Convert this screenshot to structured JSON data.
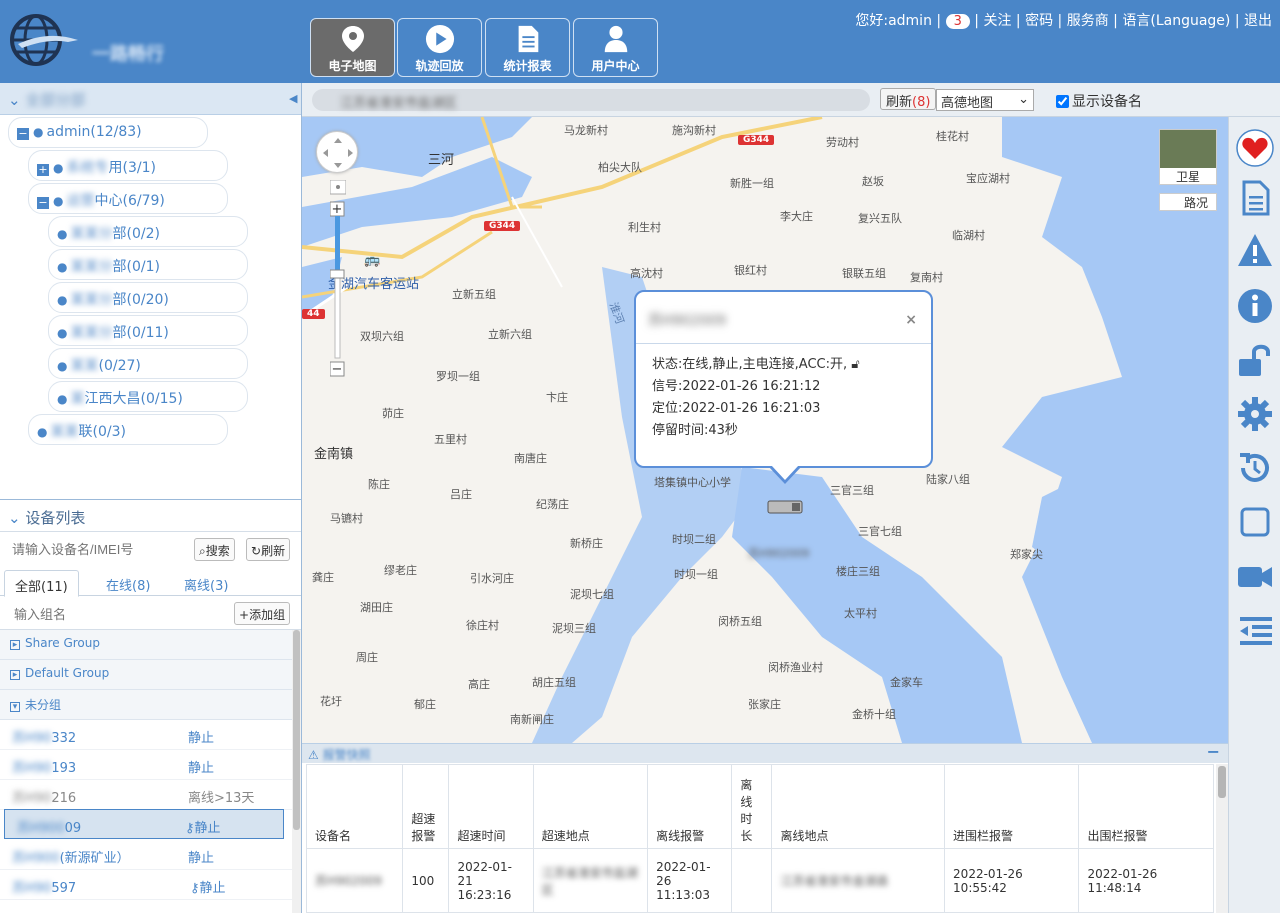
{
  "header": {
    "logo_text": "一路畅行",
    "nav": [
      {
        "label": "电子地图",
        "icon": "map-pin-icon"
      },
      {
        "label": "轨迹回放",
        "icon": "play-icon"
      },
      {
        "label": "统计报表",
        "icon": "document-icon"
      },
      {
        "label": "用户中心",
        "icon": "user-icon"
      }
    ],
    "greeting": "您好:admin",
    "message_count": "3",
    "links": [
      "关注",
      "密码",
      "服务商",
      "语言(Language)",
      "退出"
    ]
  },
  "tree": {
    "header": "全部分部",
    "nodes": [
      {
        "label": "admin(12/83)"
      },
      {
        "blur": "系统专",
        "label": "用(3/1)"
      },
      {
        "blur": "运营",
        "label": "中心(6/79)"
      },
      {
        "blur": "某某分",
        "label": "部(0/2)"
      },
      {
        "blur": "某某分",
        "label": "部(0/1)"
      },
      {
        "blur": "某某分",
        "label": "部(0/20)"
      },
      {
        "blur": "某某分",
        "label": "部(0/11)"
      },
      {
        "blur": "某某",
        "label": "(0/27)"
      },
      {
        "blur": "某",
        "label": "江西大昌(0/15)"
      },
      {
        "blur": "某某",
        "label": "联(0/3)"
      }
    ]
  },
  "devices": {
    "header": "设备列表",
    "search_placeholder": "请输入设备名/IMEI号",
    "search_btn": "搜索",
    "refresh_btn": "刷新",
    "tabs": [
      "全部(11)",
      "在线(8)",
      "离线(3)"
    ],
    "group_placeholder": "输入组名",
    "add_group": "添加组",
    "groups": [
      "Share Group",
      "Default Group",
      "未分组"
    ],
    "rows": [
      {
        "blur": "苏H90",
        "name": "332",
        "status": "静止",
        "offline": false
      },
      {
        "blur": "苏H90",
        "name": "193",
        "status": "静止",
        "offline": false
      },
      {
        "blur": "苏H90",
        "name": "216",
        "status": "离线>13天",
        "offline": true
      },
      {
        "blur": "苏H900",
        "name": "09",
        "status": "静止",
        "offline": false,
        "selected": true,
        "icon": true
      },
      {
        "blur": "苏H900",
        "name": "(新源矿业）",
        "status": "静止",
        "offline": false
      },
      {
        "blur": "苏H90",
        "name": "597",
        "status": "静止",
        "offline": false,
        "icon": true
      }
    ]
  },
  "toolbar": {
    "address": "江苏省淮安市盐湖区",
    "refresh_label": "刷新",
    "refresh_count": "(8)",
    "map_type": "高德地图",
    "show_name": "显示设备名"
  },
  "map": {
    "labels": [
      "马龙新村",
      "施沟新村",
      "劳动村",
      "桂花村",
      "三河",
      "柏尖大队",
      "新胜一组",
      "赵坂",
      "宝应湖村",
      "李大庄",
      "复兴五队",
      "利生村",
      "临湖村",
      "高沈村",
      "银红村",
      "银联五组",
      "复南村",
      "金湖汽车客运站",
      "立新五组",
      "立新六组",
      "双坝六组",
      "罗坝一组",
      "茆庄",
      "五里村",
      "卞庄",
      "金南镇",
      "南唐庄",
      "陈庄",
      "吕庄",
      "纪荡庄",
      "马镳村",
      "新桥庄",
      "时坝二组",
      "三官三组",
      "陆家八组",
      "三官七组",
      "时坝一组",
      "郑家尖",
      "龚庄",
      "缪老庄",
      "引水河庄",
      "泥坝七组",
      "楼庄三组",
      "湖田庄",
      "徐庄村",
      "泥坝三组",
      "闵桥五组",
      "太平村",
      "周庄",
      "闵桥渔业村",
      "高庄",
      "胡庄五组",
      "金家车",
      "花圩",
      "郁庄",
      "张家庄",
      "南新闸庄",
      "金桥十组",
      "塔集镇中心小学",
      "淮河"
    ],
    "roads": [
      "G344",
      "G344"
    ],
    "satellite": "卫星",
    "traffic": "路况"
  },
  "popup": {
    "title": "苏H902009",
    "status": "状态:在线,静止,主电连接,ACC:开,",
    "signal": "信号:2022-01-26 16:21:12",
    "position": "定位:2022-01-26 16:21:03",
    "stay": "停留时间:43秒"
  },
  "alarm": {
    "title": "报警快照",
    "columns": [
      "设备名",
      "超速报警",
      "超速时间",
      "超速地点",
      "离线报警",
      "离线时长",
      "离线地点",
      "进围栏报警",
      "出围栏报警"
    ],
    "row": {
      "name": "苏H902009",
      "speed": "100",
      "speed_time": "2022-01-21 16:23:16",
      "speed_place": "江苏省淮安市盐湖区",
      "offline_alarm": "2022-01-26 11:13:03",
      "offline_len": "",
      "offline_place": "江苏省淮安市金湖县",
      "fence_in": "2022-01-26 10:55:42",
      "fence_out": "2022-01-26 11:48:14"
    }
  },
  "colors": {
    "brand": "#4a86c8",
    "active_nav": "#6b6b6b",
    "water": "#a6c8f5",
    "alert_red": "#d33"
  }
}
